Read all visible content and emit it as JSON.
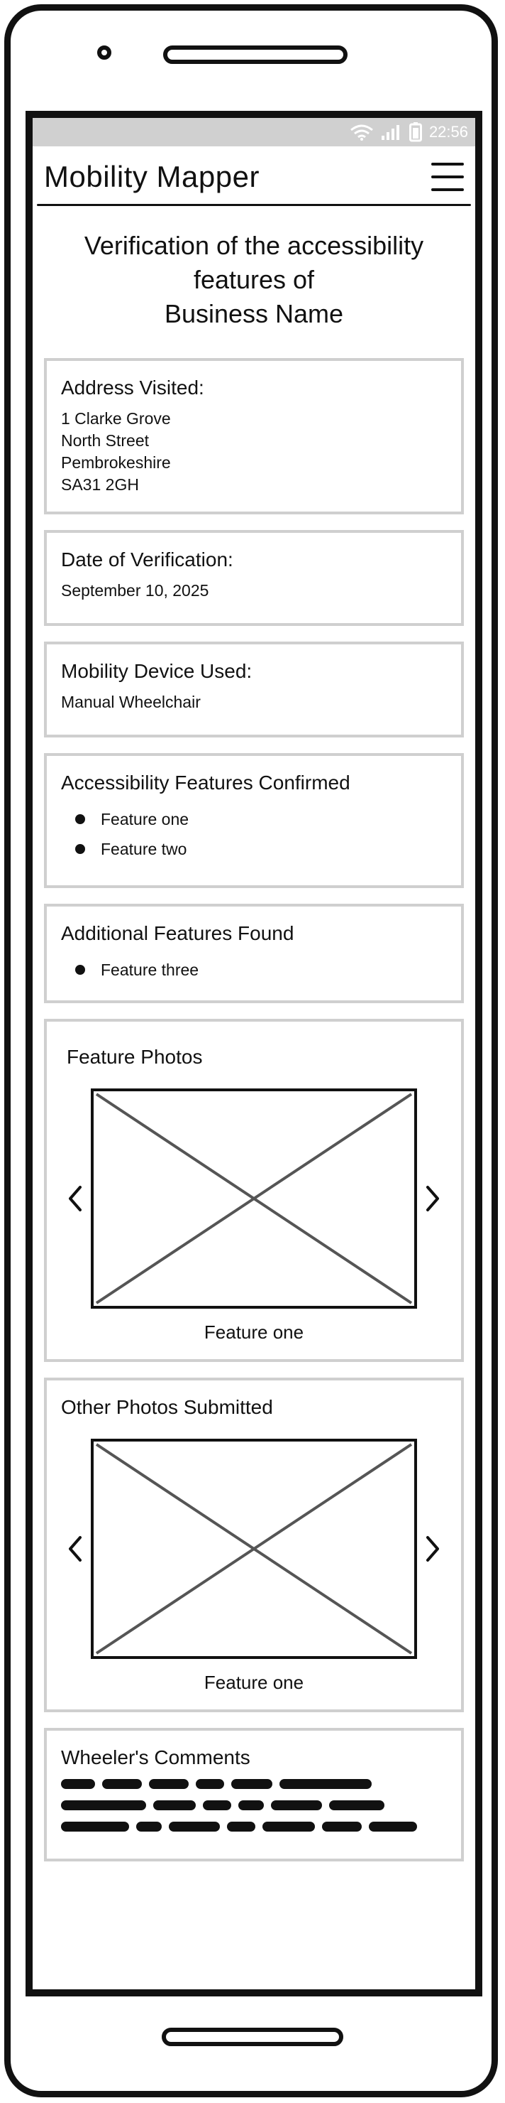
{
  "status": {
    "time": "22:56"
  },
  "header": {
    "app_title": "Mobility Mapper"
  },
  "page": {
    "title_line1": "Verification of the accessibility",
    "title_line2": "features of",
    "title_line3": "Business Name"
  },
  "address": {
    "label": "Address Visited:",
    "lines": [
      "1 Clarke Grove",
      "North Street",
      "Pembrokeshire",
      "SA31 2GH"
    ]
  },
  "date": {
    "label": "Date of Verification:",
    "value": "September 10, 2025"
  },
  "device": {
    "label": "Mobility Device Used:",
    "value": "Manual Wheelchair"
  },
  "confirmed": {
    "label": "Accessibility Features Confirmed",
    "items": [
      "Feature one",
      "Feature two"
    ]
  },
  "additional": {
    "label": "Additional Features Found",
    "items": [
      "Feature three"
    ]
  },
  "feature_photos": {
    "label": "Feature Photos",
    "caption": "Feature one"
  },
  "other_photos": {
    "label": "Other Photos Submitted",
    "caption": "Feature one"
  },
  "comments": {
    "label": "Wheeler's Comments"
  },
  "icons": {
    "wifi": "wifi-icon",
    "signal": "signal-icon",
    "battery": "battery-icon",
    "menu": "hamburger-menu-icon",
    "prev": "chevron-left-icon",
    "next": "chevron-right-icon",
    "image": "image-placeholder-icon"
  }
}
